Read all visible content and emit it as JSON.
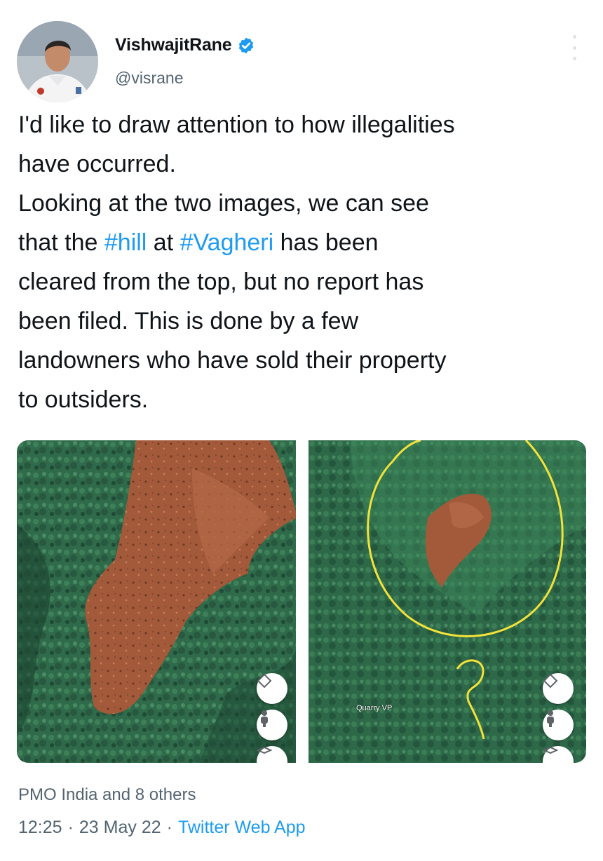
{
  "author": {
    "display_name": "VishwajitRane",
    "handle": "@visrane",
    "verified": true
  },
  "tweet": {
    "text_lines": [
      [
        {
          "t": "I'd like to draw attention to how illegalities"
        }
      ],
      [
        {
          "t": "have occurred."
        }
      ],
      [
        {
          "t": "Looking at the two images, we can see"
        }
      ],
      [
        {
          "t": "that the "
        },
        {
          "t": "#hill",
          "tag": true
        },
        {
          "t": " at "
        },
        {
          "t": "#Vagheri",
          "tag": true
        },
        {
          "t": " has been"
        }
      ],
      [
        {
          "t": "cleared from the top, but no report has"
        }
      ],
      [
        {
          "t": "been filed. This is done by a few"
        }
      ],
      [
        {
          "t": "landowners who have sold their property"
        }
      ],
      [
        {
          "t": "to outsiders."
        }
      ]
    ]
  },
  "media": {
    "right_map_label": "Quarry VP",
    "icons": [
      "compass-icon",
      "street-view-icon",
      "layers-icon"
    ]
  },
  "footer": {
    "likes": "PMO India and 8 others",
    "time": "12:25",
    "date": "23 May 22",
    "separator": "·",
    "source": "Twitter Web App"
  },
  "colors": {
    "link": "#1d9bf0",
    "secondary_text": "#536471",
    "verified_badge": "#1d9bf0",
    "cleared_area": "#a35a3a",
    "forest": "#2f6a4a",
    "annotation": "#f2e23a"
  }
}
